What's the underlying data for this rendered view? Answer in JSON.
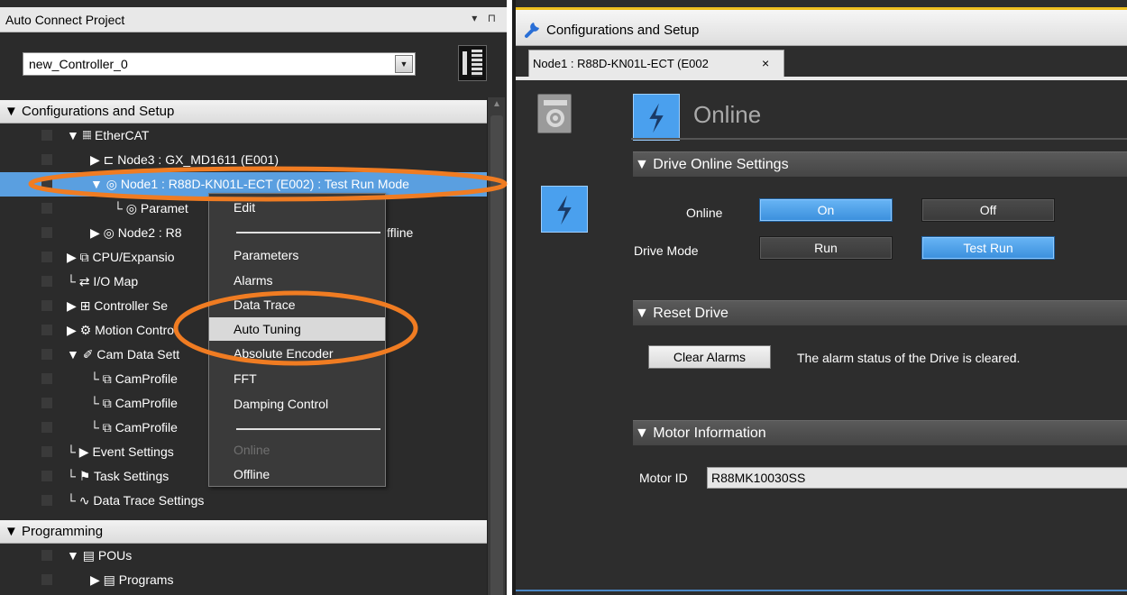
{
  "left_panel": {
    "title": "Auto Connect Project",
    "title_controls": "▾ ⊓",
    "controller_select": "new_Controller_0",
    "section_config": "▼ Configurations and Setup",
    "section_prog": "▼ Programming",
    "tree": [
      {
        "text": "▼ 𝄜 EtherCAT"
      },
      {
        "text": "▶ ⊏ Node3 : GX_MD1611 (E001)"
      },
      {
        "text": "▼ ◎ Node1 : R88D-KN01L-ECT (E002) : Test Run Mode"
      },
      {
        "text": "└ ◎ Paramet"
      },
      {
        "text": "▶ ◎ Node2 : R8"
      },
      {
        "text": "▶ ⧉ CPU/Expansio"
      },
      {
        "text": "└ ⇄ I/O Map"
      },
      {
        "text": "▶ ⊞ Controller Se"
      },
      {
        "text": "▶ ⚙ Motion Contro"
      },
      {
        "text": "▼ ✐ Cam Data Sett"
      },
      {
        "text": "└ ⧉ CamProfile"
      },
      {
        "text": "└ ⧉ CamProfile"
      },
      {
        "text": "└ ⧉ CamProfile"
      },
      {
        "text": "└ ▶ Event Settings"
      },
      {
        "text": "└ ⚑ Task Settings"
      },
      {
        "text": "└ ∿ Data Trace Settings"
      }
    ],
    "tree_partial_right": "ffline",
    "prog_tree": [
      {
        "text": "▼ ▤ POUs"
      },
      {
        "text": "▶ ▤ Programs"
      }
    ]
  },
  "context_menu": {
    "items": [
      {
        "label": "Edit",
        "state": "normal"
      },
      {
        "label": "Parameters",
        "state": "normal"
      },
      {
        "label": "Alarms",
        "state": "normal"
      },
      {
        "label": "Data Trace",
        "state": "normal"
      },
      {
        "label": "Auto Tuning",
        "state": "hover"
      },
      {
        "label": "Absolute Encoder",
        "state": "normal"
      },
      {
        "label": "FFT",
        "state": "normal"
      },
      {
        "label": "Damping Control",
        "state": "normal"
      },
      {
        "label": "Online",
        "state": "disabled"
      },
      {
        "label": "Offline",
        "state": "normal"
      }
    ]
  },
  "right_panel": {
    "title": "Configurations and Setup",
    "tab_label": "Node1 : R88D-KN01L-ECT (E002",
    "tab_close": "×",
    "online_title": "Online",
    "drive_online_hdr": "▼ Drive Online Settings",
    "online_label": "Online",
    "btn_on": "On",
    "btn_off": "Off",
    "drive_mode_label": "Drive Mode",
    "btn_run": "Run",
    "btn_test_run": "Test Run",
    "reset_hdr": "▼ Reset Drive",
    "btn_clear_alarms": "Clear Alarms",
    "reset_desc": "The alarm status of the Drive is cleared.",
    "motor_hdr": "▼ Motor Information",
    "motor_id_label": "Motor ID",
    "motor_id_value": "R88MK10030SS"
  },
  "colors": {
    "highlight": "#5a9fe0",
    "button_active": "#4aa0ee",
    "annotation": "#f07c22",
    "title_accent": "#f0c020"
  }
}
